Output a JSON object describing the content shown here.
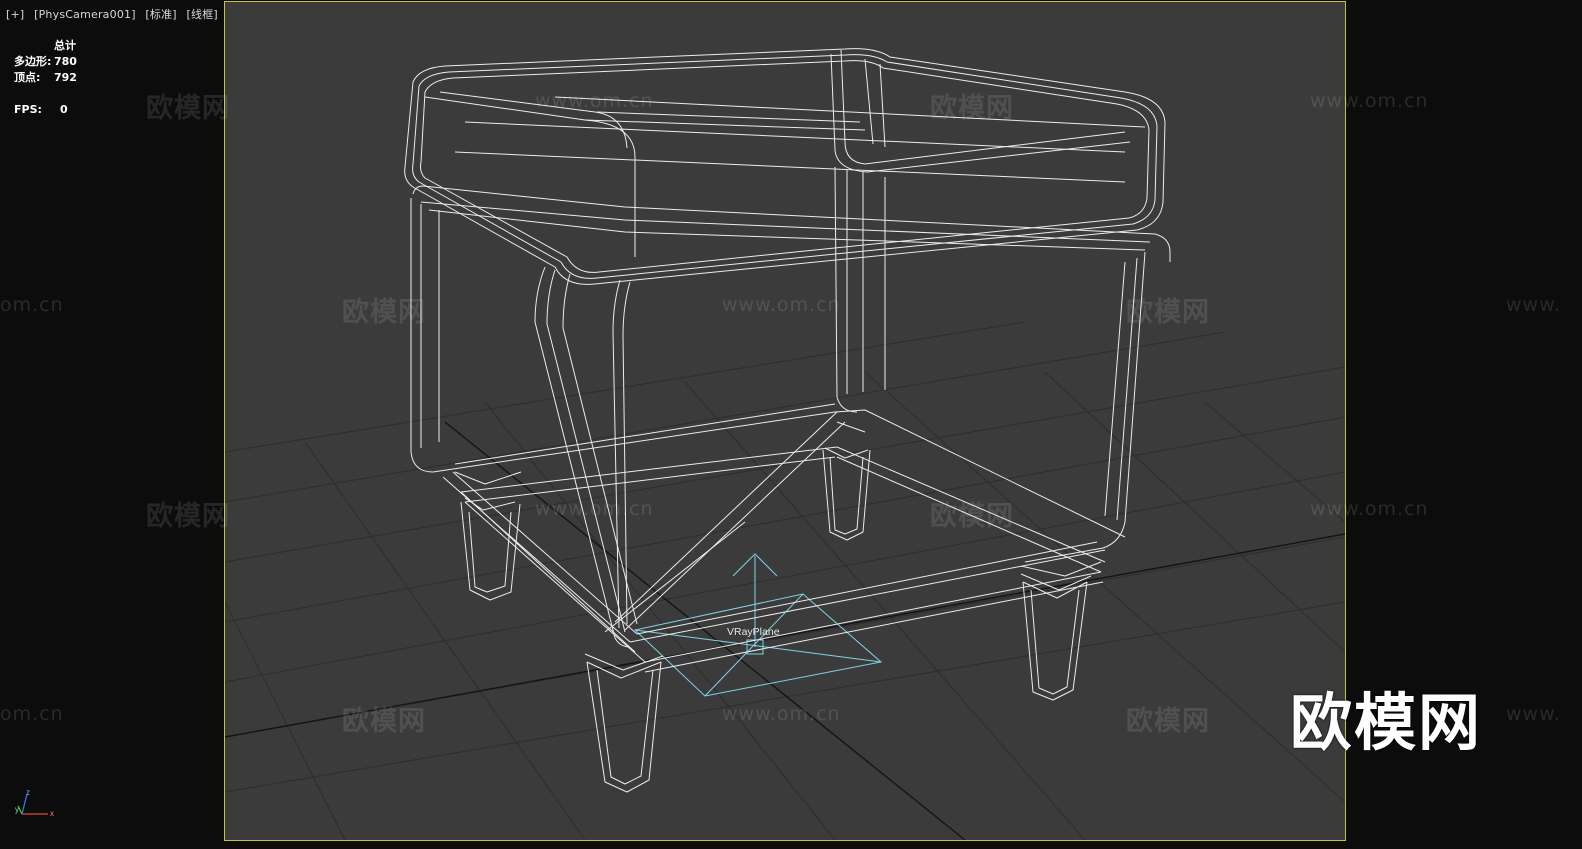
{
  "viewport": {
    "label_parts": [
      "[+]",
      "[PhysCamera001]",
      "[标准]",
      "[线框]"
    ]
  },
  "stats": {
    "header": "总计",
    "polygons_label": "多边形:",
    "polygons_value": "780",
    "vertices_label": "顶点:",
    "vertices_value": "792",
    "fps_label": "FPS:",
    "fps_value": "0"
  },
  "scene": {
    "object_label": "VRayPlane",
    "wireframe_color": "#ffffff",
    "helper_color": "#7fd3e6",
    "grid_color": "#2c2c2c",
    "background": "#3b3b3b",
    "safe_frame_color": "#c8c43a"
  },
  "watermarks": {
    "brand": "欧模网",
    "url": "www.om.cn",
    "url_cut_right": "www.",
    "url_cut_left": "om.cn"
  },
  "axis_gizmo": {
    "x": "x",
    "y": "y",
    "z": "z"
  }
}
